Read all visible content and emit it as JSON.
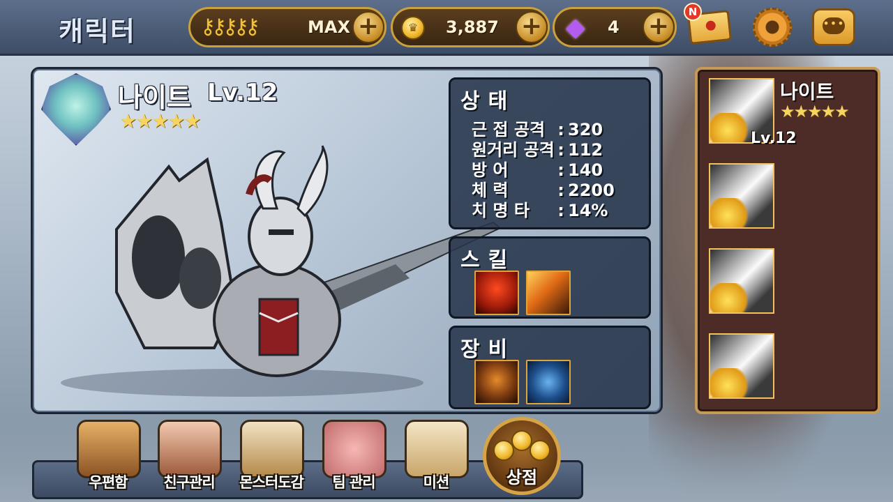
{
  "header": {
    "title": "캐릭터",
    "keys": {
      "value": "MAX",
      "icon": "key-icon"
    },
    "gold": {
      "value": "3,887",
      "icon": "coin-icon"
    },
    "gems": {
      "value": "4",
      "icon": "gem-icon"
    },
    "mail_badge": "N",
    "plus_label": "+"
  },
  "character": {
    "name": "나이트",
    "level": "Lv.12",
    "stars": "★★★★★",
    "status": {
      "title": "상태",
      "rows": [
        {
          "label": "근 접 공격",
          "value": "320"
        },
        {
          "label": "원거리 공격",
          "value": "112"
        },
        {
          "label": "방       어",
          "value": "140"
        },
        {
          "label": "체       력",
          "value": "2200"
        },
        {
          "label": "치  명  타",
          "value": "14%"
        }
      ]
    },
    "skills": {
      "title": "스킬",
      "items": [
        "demon-skill-icon",
        "spear-skill-icon"
      ]
    },
    "equipment": {
      "title": "장비",
      "items": [
        "beast-armor-icon",
        "chain-weapon-icon"
      ]
    }
  },
  "roster": {
    "selected": {
      "name": "나이트",
      "stars": "★★★★★",
      "level": "Lv.12"
    },
    "count": 4
  },
  "nav": {
    "items": [
      {
        "label": "우편함",
        "icon": "mailbox-icon"
      },
      {
        "label": "친구관리",
        "icon": "friend-icon"
      },
      {
        "label": "몬스터도감",
        "icon": "book-icon"
      },
      {
        "label": "팀 관리",
        "icon": "pig-icon"
      },
      {
        "label": "미션",
        "icon": "scroll-icon"
      }
    ],
    "shop": {
      "label": "상점",
      "icon": "crown-coins-icon"
    }
  },
  "colors": {
    "accent_gold": "#c9a23d",
    "panel_dark": "#28364c",
    "roster_bg": "#4d2b26",
    "star": "#f6d462"
  }
}
